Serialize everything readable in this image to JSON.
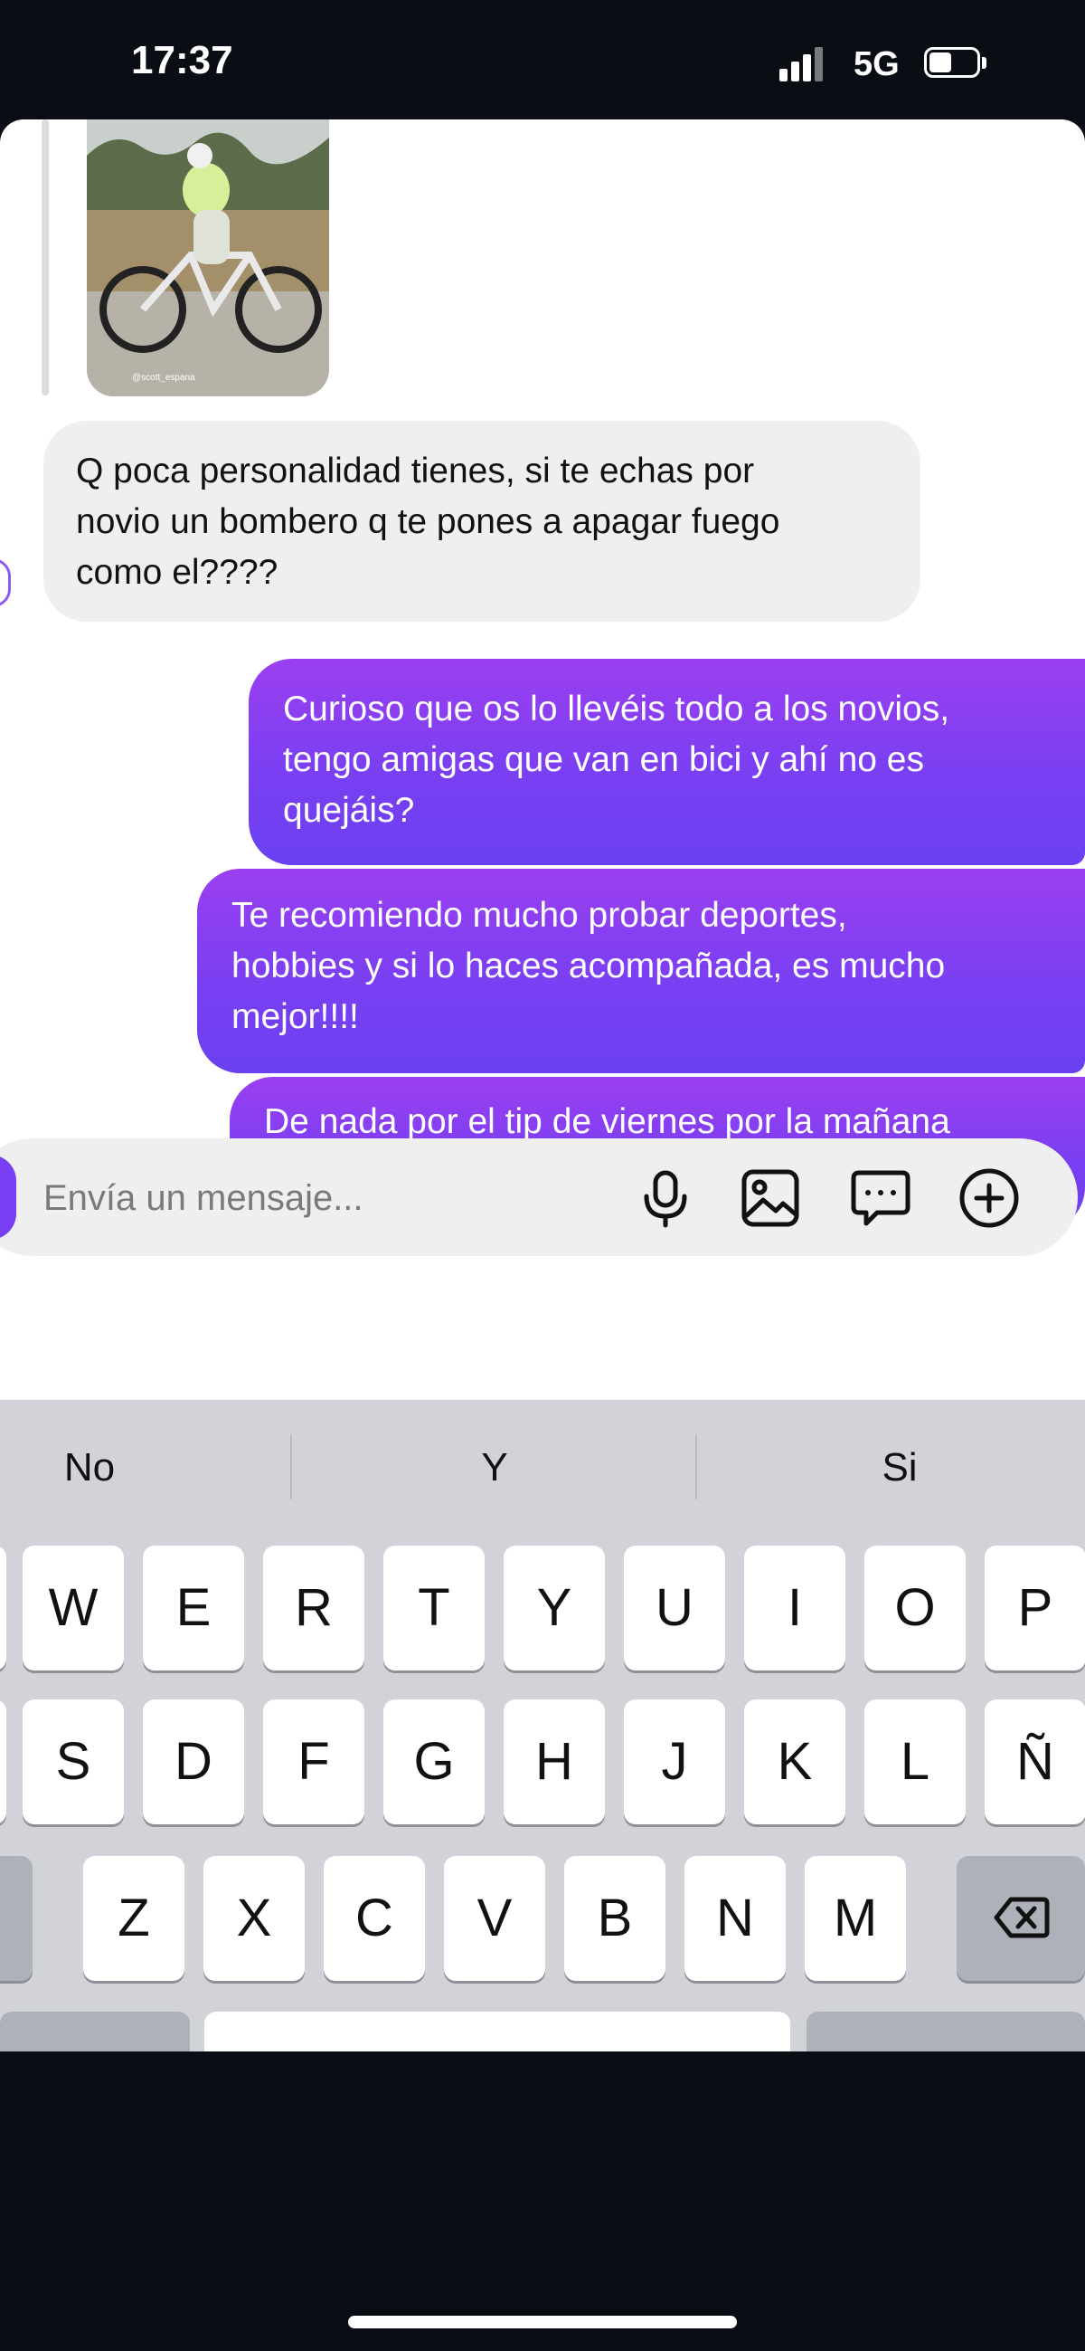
{
  "status_bar": {
    "time": "17:37",
    "network": "5G",
    "signal_bars": 3,
    "battery_level": 0.45
  },
  "chat": {
    "shared_image": {
      "caption": "@scott_espana"
    },
    "messages": [
      {
        "direction": "incoming",
        "lines": [
          "Q poca personalidad tienes, si te echas por",
          "novio un bombero q te pones a apagar fuego",
          "como el????"
        ]
      },
      {
        "direction": "outgoing",
        "lines": [
          "Curioso que os lo llevéis todo a los novios,",
          "tengo amigas que van en bici y ahí no es",
          "quejáis?"
        ]
      },
      {
        "direction": "outgoing",
        "lines": [
          "Te recomiendo mucho probar deportes,",
          "hobbies y si lo haces acompañada, es mucho",
          "mejor!!!!"
        ]
      },
      {
        "direction": "outgoing",
        "lines": [
          "De nada por el tip de viernes por la mañana",
          "💗💗💗💗💗🫂"
        ]
      }
    ]
  },
  "composer": {
    "placeholder": "Envía un mensaje...",
    "icons": [
      "microphone-icon",
      "image-icon",
      "sticker-chat-icon",
      "plus-circle-icon"
    ]
  },
  "keyboard": {
    "suggestions": [
      "No",
      "Y",
      "Si"
    ],
    "row1": [
      "Q",
      "W",
      "E",
      "R",
      "T",
      "Y",
      "U",
      "I",
      "O",
      "P"
    ],
    "row2": [
      "A",
      "S",
      "D",
      "F",
      "G",
      "H",
      "J",
      "K",
      "L",
      "Ñ"
    ],
    "row3": [
      "Z",
      "X",
      "C",
      "V",
      "B",
      "N",
      "M"
    ],
    "shift_icon": "shift-icon",
    "backspace_icon": "backspace-icon"
  },
  "colors": {
    "outgoing_bubble": "#7a3ff2",
    "incoming_bubble": "#efefef",
    "keyboard_bg": "#d1d3d9",
    "status_bg": "#0b0d14"
  }
}
